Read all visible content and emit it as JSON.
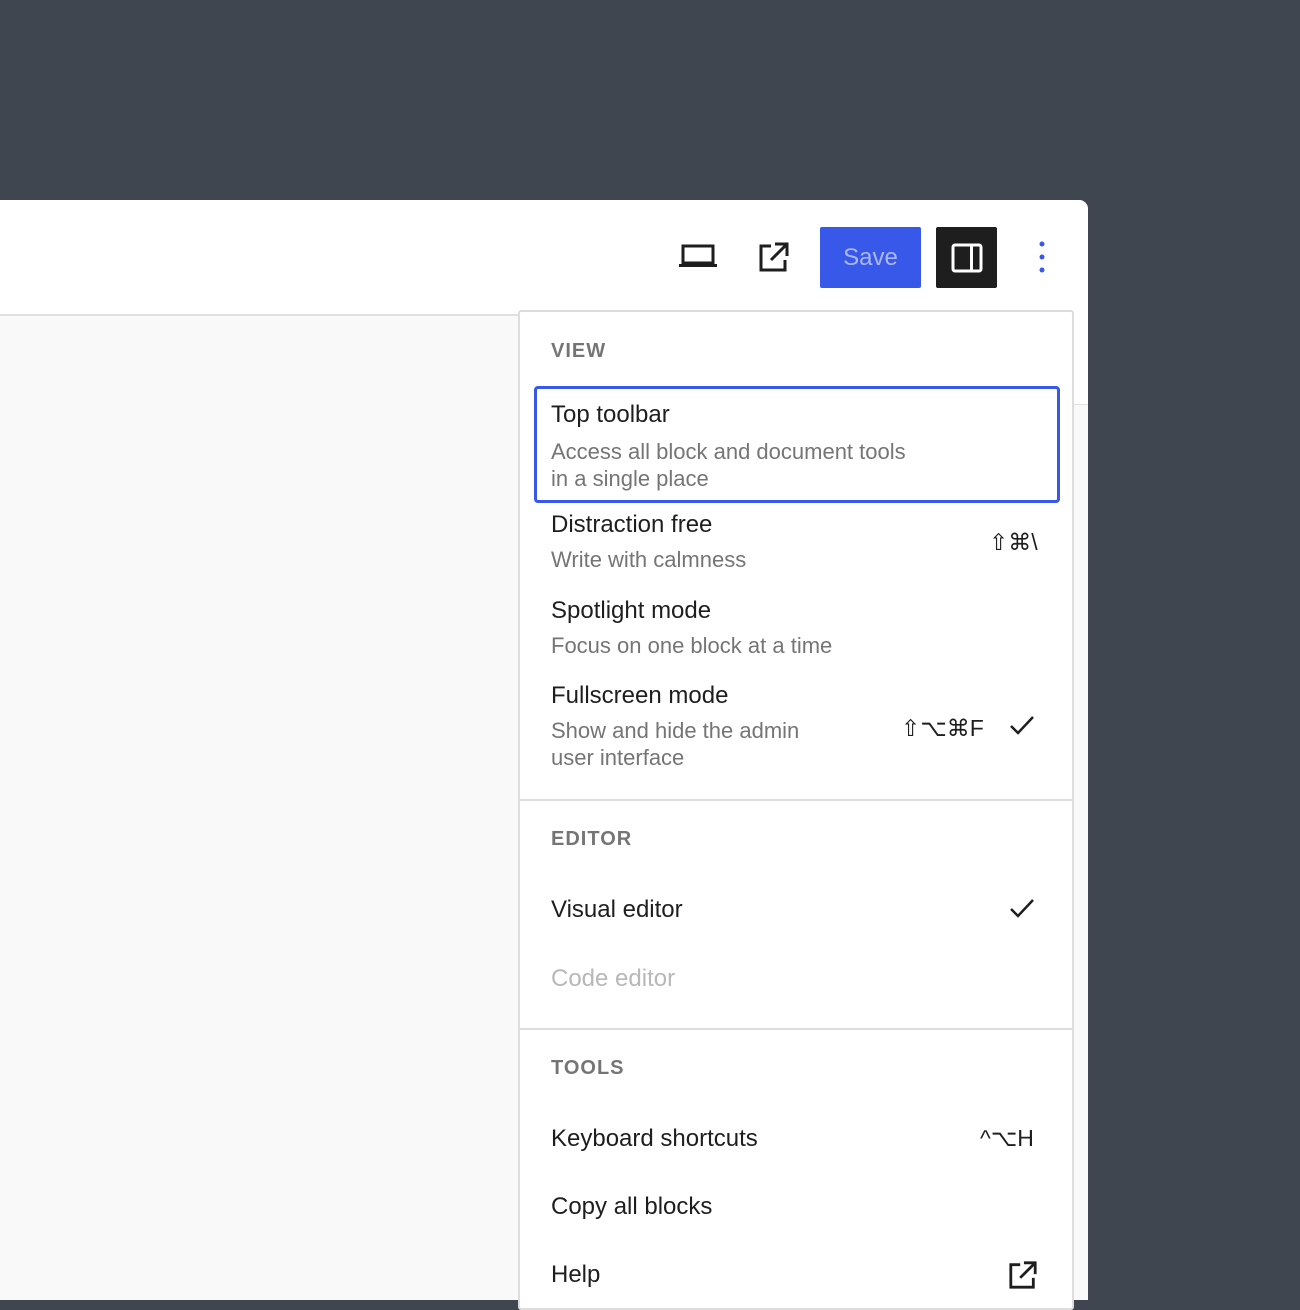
{
  "toolbar": {
    "preview_icon": "laptop-icon",
    "view_icon": "external-link-icon",
    "save_label": "Save",
    "settings_icon": "sidebar-panel-icon",
    "options_icon": "more-vertical-icon",
    "accent": "#3858e9"
  },
  "menu": {
    "view": {
      "label": "VIEW",
      "items": [
        {
          "title": "Top toolbar",
          "desc_line1": "Access all block and document tools",
          "desc_line2": "in a single place",
          "shortcut": "",
          "checked": false,
          "focused": true
        },
        {
          "title": "Distraction free",
          "desc_line1": "Write with calmness",
          "shortcut": "⇧⌘\\",
          "checked": false
        },
        {
          "title": "Spotlight mode",
          "desc_line1": "Focus on one block at a time",
          "shortcut": "",
          "checked": false
        },
        {
          "title": "Fullscreen mode",
          "desc_line1": "Show and hide the admin",
          "desc_line2": "user interface",
          "shortcut": "⇧⌥⌘F",
          "checked": true
        }
      ]
    },
    "editor": {
      "label": "EDITOR",
      "items": [
        {
          "title": "Visual editor",
          "checked": true
        },
        {
          "title": "Code editor",
          "disabled": true
        }
      ]
    },
    "tools": {
      "label": "TOOLS",
      "items": [
        {
          "title": "Keyboard shortcuts",
          "shortcut": "^⌥H"
        },
        {
          "title": "Copy all blocks"
        },
        {
          "title": "Help",
          "icon": "external-link-icon"
        }
      ]
    }
  }
}
